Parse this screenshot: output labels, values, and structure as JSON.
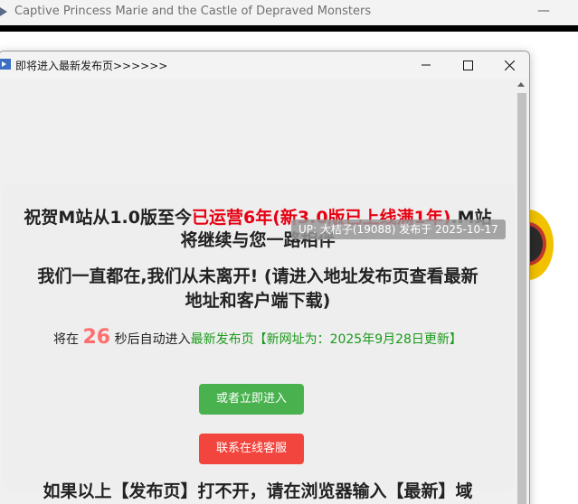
{
  "background_window": {
    "title": "Captive Princess Marie and the Castle of Depraved Monsters",
    "minimize_glyph": "—"
  },
  "dialog": {
    "title": "即将进入最新发布页>>>>>>",
    "icon": "app-icon",
    "controls": [
      "minimize-icon",
      "maximize-icon",
      "close-icon"
    ]
  },
  "content": {
    "headline_part1": "祝贺M站从1.0版至今",
    "headline_red": "已运营6年(新3.0版已上线满1年)",
    "headline_part2": ".M站",
    "headline_line2": "将继续与您一路相伴",
    "overlay_tag": "UP: 大桔子(19088) 发布于 2025-10-17",
    "subheadline_line1": "我们一直都在,我们从未离开! (请进入地址发布页查看最新",
    "subheadline_line2": "地址和客户端下载)",
    "countdown_prefix": "将在",
    "countdown_seconds": "26",
    "countdown_mid": "秒后自动进入",
    "countdown_link": "最新发布页【新网址为：2025年9月28日更新】",
    "enter_button": "或者立即进入",
    "support_button": "联系在线客服",
    "bottom_text": "如果以上【发布页】打不开，请在浏览器输入【最新】域"
  },
  "colors": {
    "red_highlight": "#e60012",
    "countdown_number": "#ff6e6e",
    "green_text": "#1a9a1a",
    "enter_button_bg": "#49b24f",
    "support_button_bg": "#f2453d"
  }
}
